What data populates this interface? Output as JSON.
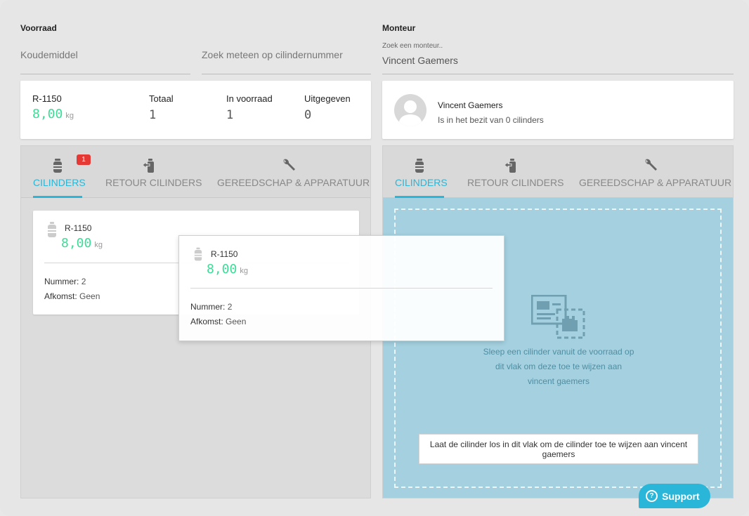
{
  "voorraad": {
    "title": "Voorraad",
    "koudemiddel_placeholder": "Koudemiddel",
    "search_placeholder": "Zoek meteen op cilindernummer",
    "summary": {
      "type": "R-1150",
      "weight": "8,00",
      "unit": "kg",
      "totaal_label": "Totaal",
      "totaal_value": "1",
      "voorraad_label": "In voorraad",
      "voorraad_value": "1",
      "uitgegeven_label": "Uitgegeven",
      "uitgegeven_value": "0"
    },
    "tabs": [
      {
        "label": "CILINDERS",
        "badge": "1",
        "icon": "cylinder-icon"
      },
      {
        "label": "RETOUR CILINDERS",
        "icon": "return-icon"
      },
      {
        "label": "GEREEDSCHAP & APPARATUUR",
        "icon": "wrench-icon"
      }
    ],
    "cylinder": {
      "type": "R-1150",
      "weight": "8,00",
      "unit": "kg",
      "nummer_label": "Nummer:",
      "nummer_value": "2",
      "afkomst_label": "Afkomst:",
      "afkomst_value": "Geen"
    }
  },
  "monteur": {
    "title": "Monteur",
    "search_label": "Zoek een monteur..",
    "search_value": "Vincent Gaemers",
    "profile": {
      "name": "Vincent Gaemers",
      "status": "Is in het bezit van 0 cilinders"
    },
    "tabs": [
      {
        "label": "CILINDERS",
        "icon": "cylinder-icon"
      },
      {
        "label": "RETOUR CILINDERS",
        "icon": "return-icon"
      },
      {
        "label": "GEREEDSCHAP & APPARATUUR",
        "icon": "wrench-icon"
      }
    ],
    "dropzone": {
      "line1": "Sleep een cilinder vanuit de voorraad op",
      "line2": "dit vlak om deze toe te wijzen aan",
      "line3": "vincent gaemers",
      "hint": "Laat de cilinder los in dit vlak om de cilinder toe te wijzen aan vincent gaemers"
    }
  },
  "drag_ghost": {
    "type": "R-1150",
    "weight": "8,00",
    "unit": "kg",
    "nummer_label": "Nummer:",
    "nummer_value": "2",
    "afkomst_label": "Afkomst:",
    "afkomst_value": "Geen"
  },
  "support_label": "Support",
  "colors": {
    "accent": "#29b6d8",
    "green": "#3ddc97",
    "badge": "#e53935",
    "dropzone": "#a4d0df"
  }
}
